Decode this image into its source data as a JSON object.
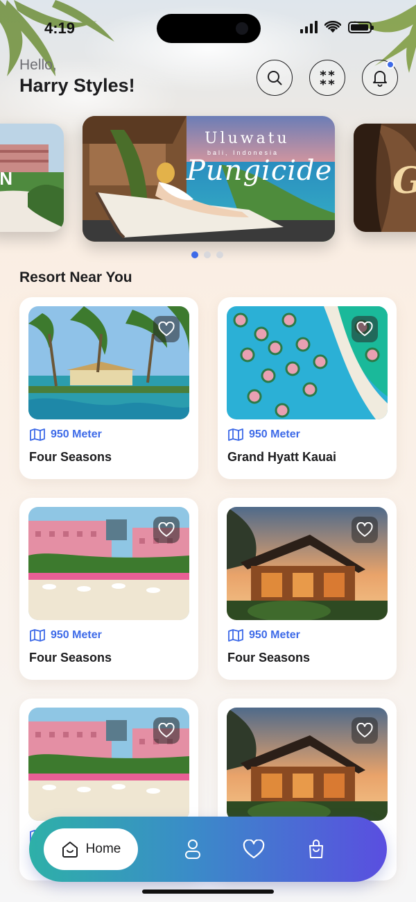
{
  "status_bar": {
    "time": "4:19"
  },
  "header": {
    "greeting": "Hello,",
    "user_name": "Harry Styles!",
    "icons": [
      "search-icon",
      "grid-icon",
      "bell-icon"
    ],
    "has_notification": true
  },
  "carousel": {
    "slides": [
      {
        "title": "",
        "subtitle": "",
        "script": "N"
      },
      {
        "title": "Uluwatu",
        "subtitle": "bali, Indonesia",
        "script": "Pungicide"
      },
      {
        "title": "",
        "subtitle": "",
        "script": "G"
      }
    ],
    "active_index": 0,
    "dot_count": 3
  },
  "section": {
    "title": "Resort Near You"
  },
  "resorts": [
    {
      "distance": "950 Meter",
      "name": "Four Seasons",
      "image": "palm-pool"
    },
    {
      "distance": "950 Meter",
      "name": "Grand Hyatt Kauai",
      "image": "aerial-lagoon"
    },
    {
      "distance": "950 Meter",
      "name": "Four Seasons",
      "image": "pink-hotel-beach"
    },
    {
      "distance": "950 Meter",
      "name": "Four Seasons",
      "image": "wood-lodge-sunset"
    },
    {
      "distance": "",
      "name": "",
      "image": "pink-hotel-beach"
    },
    {
      "distance": "",
      "name": "",
      "image": "wood-lodge-sunset"
    }
  ],
  "bottom_nav": {
    "items": [
      {
        "label": "Home",
        "icon": "home-icon",
        "active": true
      },
      {
        "label": "",
        "icon": "user-icon",
        "active": false
      },
      {
        "label": "",
        "icon": "heart-icon",
        "active": false
      },
      {
        "label": "",
        "icon": "bag-icon",
        "active": false
      }
    ]
  },
  "colors": {
    "accent": "#3d6ae8",
    "nav_start": "#2eb0a8",
    "nav_end": "#5a4ee0"
  }
}
